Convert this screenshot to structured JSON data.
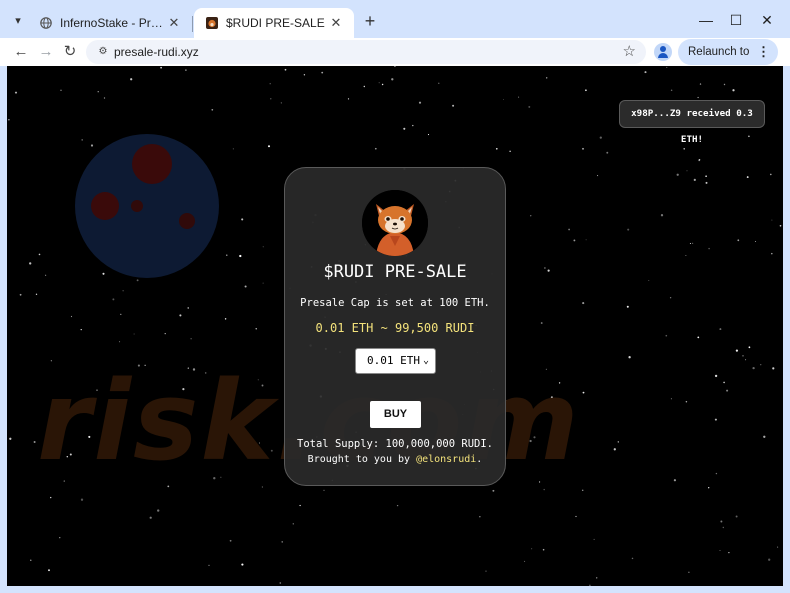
{
  "browser": {
    "tabs": [
      {
        "title": "InfernoStake - Premium Staking",
        "favicon": "globe-icon",
        "active": false
      },
      {
        "title": "$RUDI PRE-SALE",
        "favicon": "rudi-favicon",
        "active": true
      }
    ],
    "new_tab_symbol": "+",
    "address_bar": {
      "url": "presale-rudi.xyz"
    },
    "relaunch_label": "Relaunch to update",
    "colors": {
      "frame": "#d3e3fd",
      "toolbar": "#ffffff",
      "omnibox": "#f0f3fa"
    }
  },
  "page": {
    "background": "#000000",
    "toast": {
      "message": "x98P...Z9 received 0.3 ETH!"
    },
    "card": {
      "title": "$RUDI PRE-SALE",
      "cap_text": "Presale Cap is set at 100 ETH.",
      "rate_text": "0.01 ETH ~ 99,500 RUDI",
      "amount_select": {
        "selected": "0.01 ETH"
      },
      "buy_label": "BUY",
      "supply_text": "Total Supply: 100,000,000 RUDI.",
      "brought_prefix": "Brought to you by",
      "handle": "@elonsrudi",
      "brought_suffix": "."
    },
    "accent_color": "#f3e27b"
  }
}
